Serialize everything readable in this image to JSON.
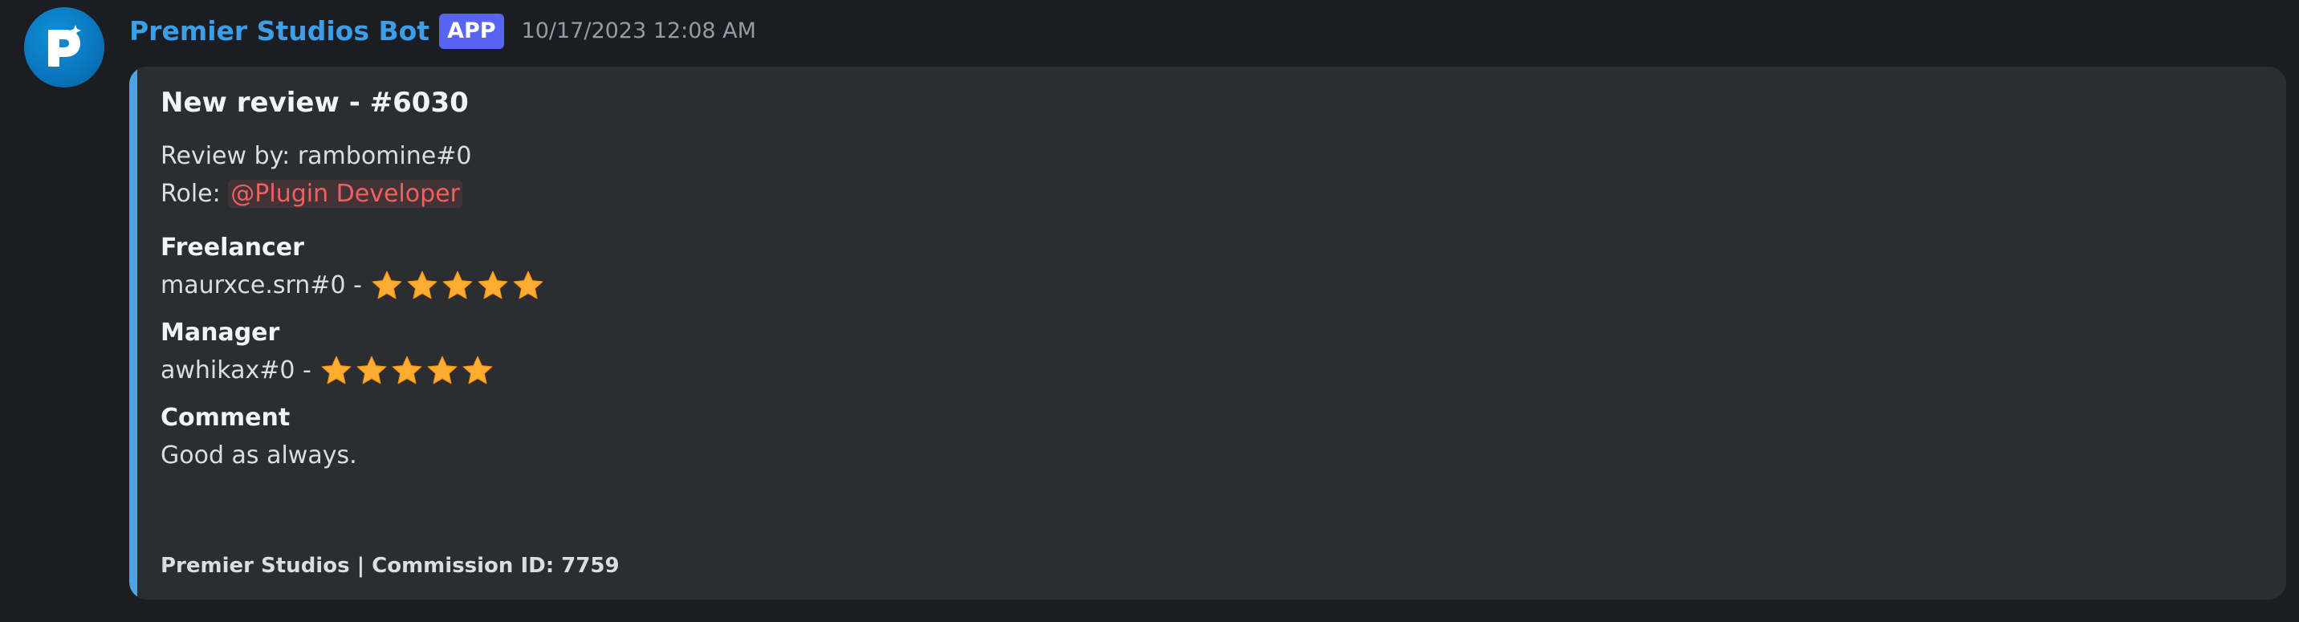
{
  "author": {
    "name": "Premier Studios Bot",
    "badge": "APP",
    "timestamp": "10/17/2023 12:08 AM",
    "avatar_icon": "premier-studios-logo",
    "name_color": "#3b9ee8"
  },
  "embed": {
    "accent_color": "#4ea3e3",
    "title": "New review - #6030",
    "review_by_label": "Review by: ",
    "review_by_value": "rambomine#0",
    "role_label": "Role: ",
    "role_mention": "@Plugin Developer",
    "fields": [
      {
        "name": "Freelancer",
        "value": "maurxce.srn#0 - ",
        "stars": 5
      },
      {
        "name": "Manager",
        "value": "awhikax#0 - ",
        "stars": 5
      },
      {
        "name": "Comment",
        "value": "Good as always."
      }
    ],
    "footer": "Premier Studios | Commission ID: 7759"
  }
}
